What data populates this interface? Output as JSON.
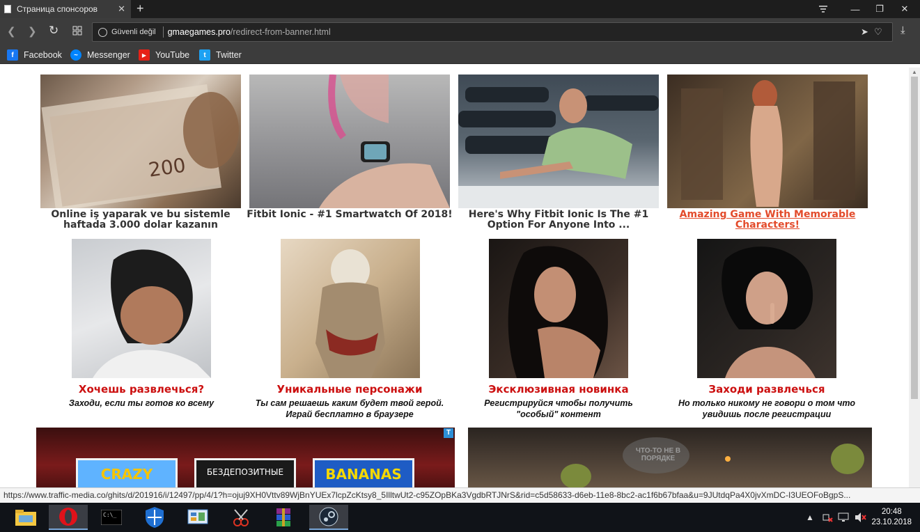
{
  "browser": {
    "tab_title": "Страница спонсоров",
    "tab_close": "✕",
    "new_tab": "+",
    "security_label": "Güvenli değil",
    "url_domain": "gmaegames.pro",
    "url_path": "/redirect-from-banner.html",
    "window_controls": [
      "—",
      "❐",
      "✕"
    ]
  },
  "bookmarks": [
    {
      "label": "Facebook",
      "icon": "facebook-icon",
      "color": "#1877f2",
      "glyph": "f"
    },
    {
      "label": "Messenger",
      "icon": "messenger-icon",
      "color": "#0084ff",
      "glyph": "~"
    },
    {
      "label": "YouTube",
      "icon": "youtube-icon",
      "color": "#e62117",
      "glyph": "▶"
    },
    {
      "label": "Twitter",
      "icon": "twitter-icon",
      "color": "#1da1f2",
      "glyph": "t"
    }
  ],
  "row1": [
    {
      "caption": "Online iş yaparak ve bu sistemle haftada 3.000 dolar kazanın",
      "image": "money-stack-image"
    },
    {
      "caption": "Fitbit Ionic - #1 Smartwatch Of 2018!",
      "image": "smartwatch-image"
    },
    {
      "caption": "Here's Why Fitbit Ionic Is The #1 Option For Anyone Into ...",
      "image": "gym-woman-image"
    },
    {
      "caption": "Amazing Game With Memorable Characters!",
      "image": "game-character-image"
    }
  ],
  "row2": [
    {
      "title": "Хочешь развлечься?",
      "desc": "Заходи, если ты готов ко всему"
    },
    {
      "title": "Уникальные персонажи",
      "desc": "Ты сам решаешь каким будет твой герой. Играй бесплатно в браузере"
    },
    {
      "title": "Эксклюзивная новинка",
      "desc": "Регистрируйся чтобы получить \"особый\" контент"
    },
    {
      "title": "Заходи развлечься",
      "desc": "Но только никому не говори о том что увидишь после регистрации"
    }
  ],
  "banners": {
    "left_slots": [
      "CRAZY MONKEY",
      "БЕЗДЕПОЗИТНЫЕ",
      "BANANAS"
    ],
    "left_badge": "T",
    "right_sign": "ЧТО-ТО НЕ В ПОРЯДКЕ"
  },
  "status_url": "https://www.traffic-media.co/ghits/d/201916/i/12497/pp/4/1?h=ojuj9XH0Vttv89WjBnYUEx7lcpZcKtsy8_5IlltwUt2-c95ZOpBKa3VgdbRTJNrS&rid=c5d58633-d6eb-11e8-8bc2-ac1f6b67bfaa&u=9JUtdqPa4X0jvXmDC-I3UEOFoBgpS...",
  "taskbar": {
    "time": "20:48",
    "date": "23.10.2018"
  }
}
